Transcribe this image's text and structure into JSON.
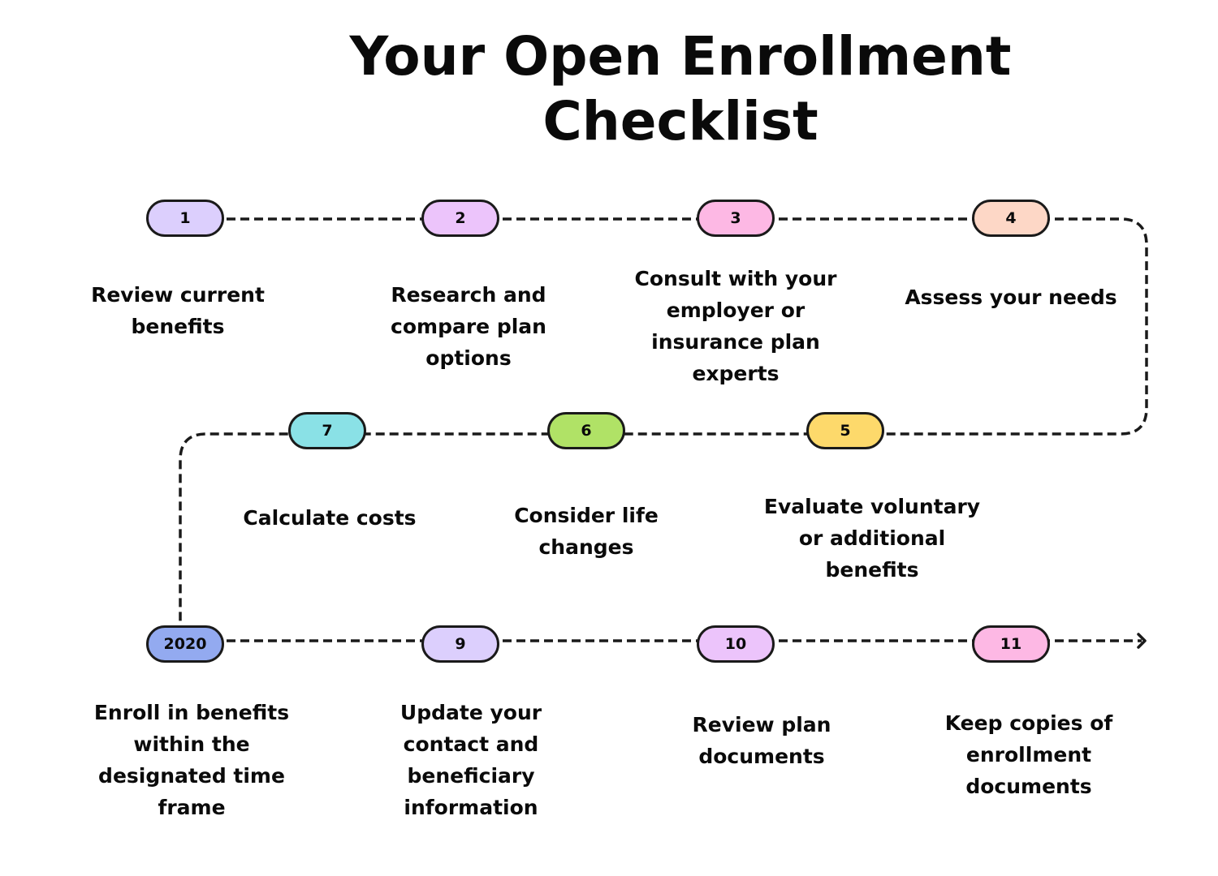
{
  "title_line1": "Your Open Enrollment",
  "title_line2": "Checklist",
  "steps": [
    {
      "badge": "1",
      "color": "#dccffd",
      "label": [
        "Review current",
        "benefits"
      ]
    },
    {
      "badge": "2",
      "color": "#ecc4fb",
      "label": [
        "Research and",
        "compare plan",
        "options"
      ]
    },
    {
      "badge": "3",
      "color": "#fdb8e4",
      "label": [
        "Consult with your",
        "employer or",
        "insurance plan",
        "experts"
      ]
    },
    {
      "badge": "4",
      "color": "#fdd7c6",
      "label": [
        "Assess your needs"
      ]
    },
    {
      "badge": "5",
      "color": "#fdd96b",
      "label": [
        "Evaluate voluntary",
        "or additional",
        "benefits"
      ]
    },
    {
      "badge": "6",
      "color": "#b0e266",
      "label": [
        "Consider life",
        "changes"
      ]
    },
    {
      "badge": "7",
      "color": "#8ae1e6",
      "label": [
        "Calculate costs"
      ]
    },
    {
      "badge": "2020",
      "color": "#93aaf0",
      "label": [
        "Enroll in benefits",
        "within the",
        "designated time",
        "frame"
      ]
    },
    {
      "badge": "9",
      "color": "#dccffd",
      "label": [
        "Update your",
        "contact and",
        "beneficiary",
        "information"
      ]
    },
    {
      "badge": "10",
      "color": "#ecc4fb",
      "label": [
        "Review plan",
        "documents"
      ]
    },
    {
      "badge": "11",
      "color": "#fdb8e4",
      "label": [
        "Keep copies of",
        "enrollment",
        "documents"
      ]
    }
  ]
}
